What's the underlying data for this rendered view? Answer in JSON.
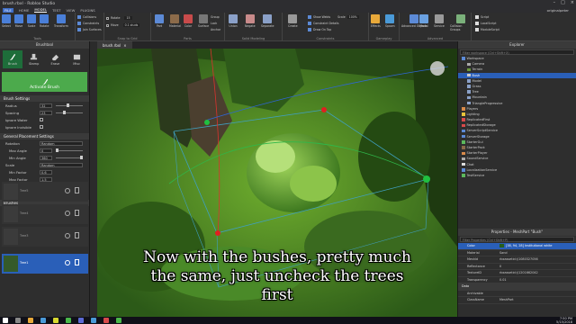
{
  "window": {
    "title": "brush.rbxl - Roblox Studio",
    "minimize": "–",
    "maximize": "□",
    "close": "×"
  },
  "menu": {
    "file": "FILE",
    "items": [
      "HOME",
      "MODEL",
      "TEST",
      "VIEW",
      "PLUGINS"
    ],
    "active": "MODEL",
    "user": "originalpeter"
  },
  "ribbon": {
    "tools": {
      "buttons": [
        "Select",
        "Move",
        "Scale",
        "Rotate",
        "Transform"
      ],
      "checks": [
        "Collisions",
        "Constraints",
        "Join Surfaces"
      ],
      "label": "Tools"
    },
    "snap": {
      "rotate_label": "Rotate",
      "rotate_value": "15",
      "move_label": "Move",
      "move_value": "0.1 studs",
      "label": "Snap to Grid"
    },
    "parts": {
      "buttons": [
        "Part",
        "Material",
        "Color"
      ],
      "extra": [
        "Group",
        "Lock",
        "Anchor"
      ],
      "surface": "Surface",
      "label": "Parts"
    },
    "solid": {
      "buttons": [
        "Union",
        "Negate",
        "Separate"
      ],
      "label": "Solid Modeling"
    },
    "constraints": {
      "buttons": [
        "Create"
      ],
      "lines": [
        "Show Welds",
        "Constraint Details",
        "Draw On Top"
      ],
      "scale_label": "Scale",
      "scale_value": "100%",
      "label": "Constraints"
    },
    "gameplay": {
      "buttons": [
        "Effects",
        "Spawn"
      ],
      "label": "Gameplay"
    },
    "advanced": {
      "buttons": [
        "Advanced Objects",
        "Model",
        "Service",
        "Collision Groups"
      ],
      "label": "Advanced",
      "scripts": [
        "Script",
        "LocalScript",
        "ModuleScript"
      ]
    }
  },
  "viewport_tab": {
    "label": "brush.rbxl",
    "close": "×"
  },
  "brush_panel": {
    "title": "Brushtool",
    "modes": [
      "Brush",
      "Stamp",
      "Erase",
      "Misc"
    ],
    "activate": "Activate Brush",
    "settings_title": "Brush Settings",
    "radius": {
      "label": "Radius",
      "value": "32"
    },
    "spacing": {
      "label": "Spacing",
      "value": "23"
    },
    "ignore_water": "Ignore Water",
    "ignore_invisible": "Ignore Invisible",
    "placement_title": "General Placement Settings",
    "rotation": {
      "label": "Rotation",
      "value": "Random"
    },
    "max_angle": {
      "label": "Max Angle",
      "value": "0"
    },
    "min_angle": {
      "label": "Min Angle",
      "value": "360"
    },
    "scale": {
      "label": "Scale",
      "value": "Random"
    },
    "min_factor": {
      "label": "Min Factor",
      "value": "0.6"
    },
    "max_factor": {
      "label": "Max Factor",
      "value": "1.5"
    },
    "wobble": {
      "label": "Wobble",
      "value": "Do not wobble"
    },
    "orientation": {
      "label": "Orientation",
      "value": "Normal"
    },
    "brushes_title": "Brushes",
    "brushes": [
      {
        "name": "Tree5"
      },
      {
        "name": "Tree4"
      },
      {
        "name": "Tree3"
      },
      {
        "name": "Bush"
      },
      {
        "name": "Tree1"
      }
    ]
  },
  "explorer": {
    "title": "Explorer",
    "filter": "Filter workspace (Ctrl+Shift+X)",
    "items": [
      "Workspace",
      "Camera",
      "Terrain",
      "Bush",
      "Model",
      "Grass",
      "Tree",
      "Mountain",
      "TriangleProgressive",
      "Players",
      "Lighting",
      "ReplicatedFirst",
      "ReplicatedStorage",
      "ServerScriptService",
      "ServerStorage",
      "StarterGui",
      "StarterPack",
      "StarterPlayer",
      "SoundService",
      "Chat",
      "LocalizationService",
      "TestService"
    ],
    "selected": "Bush"
  },
  "properties": {
    "title": "Properties - MeshPart \"Bush\"",
    "filter": "Filter Properties (Ctrl+Shift+P)",
    "rows": [
      {
        "key": "Color",
        "value": "[38, 94, 28] Institutional white"
      },
      {
        "key": "Material",
        "value": "Sand"
      },
      {
        "key": "MeshId",
        "value": "rbxassetid://1080327056"
      },
      {
        "key": "Reflectance",
        "value": "0"
      },
      {
        "key": "TextureID",
        "value": "rbxassetid://1201662042"
      },
      {
        "key": "Transparency",
        "value": "0.01"
      }
    ],
    "data_section": "Data",
    "data_rows": [
      {
        "key": "Archivable",
        "value": ""
      },
      {
        "key": "ClassName",
        "value": "MeshPart"
      }
    ],
    "colors": {
      "swatch": "#265e1c"
    }
  },
  "caption": {
    "line1": "Now with the bushes, pretty much",
    "line2": "the same, just uncheck the trees",
    "line3": "first"
  },
  "taskbar": {
    "time": "7:50 PM",
    "date": "5/15/2018"
  }
}
